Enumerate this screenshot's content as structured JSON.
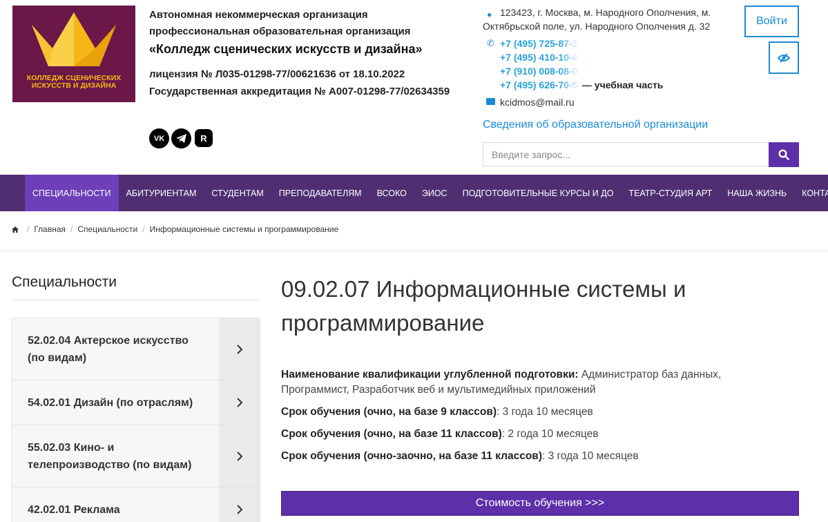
{
  "logo": {
    "text": "КОЛЛЕДЖ СЦЕНИЧЕСКИХ ИСКУССТВ И ДИЗАЙНА",
    "bg_color": "#6b1848",
    "accent_color": "#f6b617"
  },
  "org": {
    "line1": "Автономная некоммерческая организация",
    "line2": "профессиональная образовательная организация",
    "name": "«Колледж сценических искусств и дизайна»",
    "license": "лицензия № Л035-01298-77/00621636 от 18.10.2022",
    "accreditation": "Государственная аккредитация № А007-01298-77/02634359",
    "social": [
      "vk-icon",
      "telegram-icon",
      "rutube-icon"
    ]
  },
  "contacts": {
    "address": "123423, г. Москва, м. Народного Ополчения, м. Октябрьской поле, ул. Народного Ополчения д. 32",
    "phones": [
      {
        "number": "+7 (495) 725-87-3",
        "note": ""
      },
      {
        "number": "+7 (495) 410-10-4",
        "note": ""
      },
      {
        "number": "+7 (910) 008-08-0",
        "note": ""
      },
      {
        "number": "+7 (495) 626-70-5",
        "note": "— учебная часть"
      }
    ],
    "email": "kcidmos@mail.ru",
    "edu_link": "Сведения об образовательной организации"
  },
  "header": {
    "login_label": "Войти",
    "search_placeholder": "Введите запрос...",
    "accent_color": "#1a8bd6"
  },
  "nav": {
    "bg_color": "#4f2f72",
    "active_color": "#6d3fb8",
    "items": [
      {
        "label": "Специальности",
        "active": true
      },
      {
        "label": "Абитуриентам"
      },
      {
        "label": "Студентам"
      },
      {
        "label": "Преподавателям"
      },
      {
        "label": "ВСОКО"
      },
      {
        "label": "ЭИОС"
      },
      {
        "label": "Подготовительные курсы и ДО"
      },
      {
        "label": "Театр-студия АРТ"
      },
      {
        "label": "Наша жизнь"
      },
      {
        "label": "Контакты"
      }
    ]
  },
  "breadcrumb": {
    "items": [
      "Главная",
      "Специальности",
      "Информационные системы и программирование"
    ]
  },
  "sidebar": {
    "title": "Специальности",
    "items": [
      {
        "label": "52.02.04 Актерское искусство (по видам)"
      },
      {
        "label": "54.02.01 Дизайн (по отраслям)"
      },
      {
        "label": "55.02.03 Кино- и телепроизводство (по видам)"
      },
      {
        "label": "42.02.01 Реклама"
      }
    ]
  },
  "main": {
    "title": "09.02.07 Информационные системы и программирование",
    "qualification_label": "Наименование квалификации углубленной подготовки:",
    "qualification_value": " Администратор баз данных, Программист, Разработчик веб и мультимедийных приложений",
    "duration9_label": "Срок обучения (очно, на базе 9 классов)",
    "duration9_value": ": 3 года 10 месяцев",
    "duration11_label": "Срок обучения (очно, на базе 11 классов)",
    "duration11_value": ": 2 года 10 месяцев",
    "duration11z_label": "Срок обучения (очно-заочно, на базе 11 классов)",
    "duration11z_value": ": 3 года 10 месяцев",
    "cost_button": "Стоимость обучения >>>",
    "button_color": "#5d2fa8"
  }
}
